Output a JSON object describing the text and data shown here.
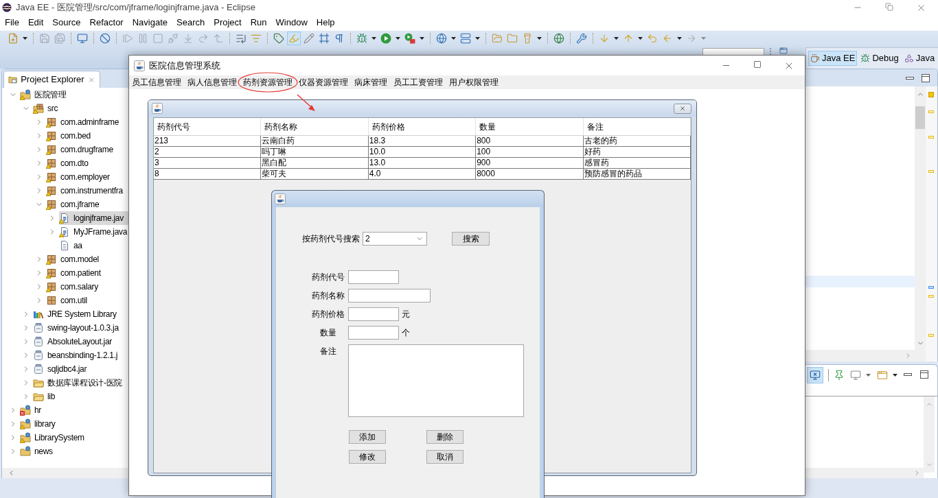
{
  "window": {
    "title": "Java EE - 医院管理/src/com/jframe/loginjframe.java - Eclipse"
  },
  "menu": [
    "File",
    "Edit",
    "Source",
    "Refactor",
    "Navigate",
    "Search",
    "Project",
    "Run",
    "Window",
    "Help"
  ],
  "highlighter_toggle": {
    "selected": true
  },
  "perspectives": [
    {
      "label": "Java EE",
      "selected": true
    },
    {
      "label": "Debug",
      "selected": false
    },
    {
      "label": "Java",
      "selected": false
    }
  ],
  "project_explorer": {
    "title": "Project Explorer",
    "items": [
      {
        "label": "医院管理",
        "kind": "project",
        "warning": true,
        "error": false,
        "expanded": true,
        "selected": false,
        "children": [
          {
            "label": "src",
            "kind": "source",
            "warning": true,
            "error": false,
            "expanded": true,
            "selected": false,
            "children": [
              {
                "label": "com.adminframe",
                "kind": "package",
                "warning": true,
                "error": false,
                "expanded": false,
                "selected": false
              },
              {
                "label": "com.bed",
                "kind": "package",
                "warning": true,
                "error": false,
                "expanded": false,
                "selected": false
              },
              {
                "label": "com.drugframe",
                "kind": "package",
                "warning": true,
                "error": false,
                "expanded": false,
                "selected": false
              },
              {
                "label": "com.dto",
                "kind": "package",
                "warning": true,
                "error": false,
                "expanded": false,
                "selected": false
              },
              {
                "label": "com.employer",
                "kind": "package",
                "warning": true,
                "error": false,
                "expanded": false,
                "selected": false
              },
              {
                "label": "com.instrumentfra",
                "kind": "package",
                "warning": true,
                "error": false,
                "expanded": false,
                "selected": false
              },
              {
                "label": "com.jframe",
                "kind": "package",
                "warning": true,
                "error": false,
                "expanded": true,
                "selected": false,
                "children": [
                  {
                    "label": "loginjframe.jav",
                    "kind": "java",
                    "warning": true,
                    "error": false,
                    "expanded": false,
                    "selected": true
                  },
                  {
                    "label": "MyJFrame.java",
                    "kind": "java",
                    "warning": true,
                    "error": false,
                    "expanded": false,
                    "selected": false
                  },
                  {
                    "label": "aa",
                    "kind": "text",
                    "warning": false,
                    "error": false,
                    "selected": false
                  }
                ]
              },
              {
                "label": "com.model",
                "kind": "package",
                "warning": true,
                "error": false,
                "expanded": false,
                "selected": false
              },
              {
                "label": "com.patient",
                "kind": "package",
                "warning": true,
                "error": false,
                "expanded": false,
                "selected": false
              },
              {
                "label": "com.salary",
                "kind": "package",
                "warning": true,
                "error": false,
                "expanded": false,
                "selected": false
              },
              {
                "label": "com.util",
                "kind": "package",
                "warning": false,
                "error": false,
                "expanded": false,
                "selected": false
              }
            ]
          },
          {
            "label": "JRE System Library",
            "kind": "library",
            "warning": false,
            "error": false,
            "expanded": false,
            "selected": false
          },
          {
            "label": "swing-layout-1.0.3.ja",
            "kind": "jar",
            "warning": false,
            "error": false,
            "expanded": false,
            "selected": false
          },
          {
            "label": "AbsoluteLayout.jar",
            "kind": "jar",
            "warning": false,
            "error": false,
            "expanded": false,
            "selected": false
          },
          {
            "label": "beansbinding-1.2.1.j",
            "kind": "jar",
            "warning": false,
            "error": false,
            "expanded": false,
            "selected": false
          },
          {
            "label": "sqljdbc4.jar",
            "kind": "jar",
            "warning": false,
            "error": false,
            "expanded": false,
            "selected": false
          },
          {
            "label": "数据库课程设计-医院",
            "kind": "folder",
            "warning": false,
            "error": false,
            "expanded": false,
            "selected": false
          },
          {
            "label": "lib",
            "kind": "folder",
            "warning": false,
            "error": false,
            "expanded": false,
            "selected": false
          }
        ]
      },
      {
        "label": "hr",
        "kind": "project",
        "warning": false,
        "error": true,
        "expanded": false,
        "selected": false
      },
      {
        "label": "library",
        "kind": "project",
        "warning": true,
        "error": false,
        "expanded": false,
        "selected": false
      },
      {
        "label": "LibrarySystem",
        "kind": "project",
        "warning": true,
        "error": false,
        "expanded": false,
        "selected": false
      },
      {
        "label": "news",
        "kind": "project",
        "warning": false,
        "error": false,
        "expanded": false,
        "selected": false
      }
    ]
  },
  "bottom_panel": {
    "monitor_toggle": {
      "selected": true
    }
  },
  "app_window": {
    "title": "医院信息管理系统",
    "menu": [
      {
        "label": "员工信息管理",
        "highlighted": false
      },
      {
        "label": "病人信息管理",
        "highlighted": false
      },
      {
        "label": "药剂资源管理",
        "highlighted": true
      },
      {
        "label": "仪器资源管理",
        "highlighted": false
      },
      {
        "label": "病床管理",
        "highlighted": false
      },
      {
        "label": "员工工资管理",
        "highlighted": false
      },
      {
        "label": "用户权限管理",
        "highlighted": false
      }
    ]
  },
  "table": {
    "columns": [
      "药剂代号",
      "药剂名称",
      "药剂价格",
      "数量",
      "备注"
    ],
    "rows": [
      [
        "213",
        "云南白药",
        "18.3",
        "800",
        "古老的药"
      ],
      [
        "2",
        "吗丁啉",
        "10.0",
        "100",
        "好药"
      ],
      [
        "3",
        "黑白配",
        "13.0",
        "900",
        "感冒药"
      ],
      [
        "8",
        "柴可夫",
        "4.0",
        "8000",
        "预防感冒的药品"
      ]
    ]
  },
  "dialog": {
    "search": {
      "label": "按药剂代号搜索",
      "value": "2",
      "button": "搜索"
    },
    "fields": [
      {
        "label": "药剂代号",
        "kind": "short"
      },
      {
        "label": "药剂名称",
        "kind": "wide"
      },
      {
        "label": "药剂价格",
        "kind": "short",
        "suffix": "元"
      },
      {
        "label": "数量",
        "kind": "short",
        "suffix": "个"
      },
      {
        "label": "备注",
        "kind": "area"
      }
    ],
    "buttons": [
      "添加",
      "删除",
      "修改",
      "取消"
    ]
  }
}
